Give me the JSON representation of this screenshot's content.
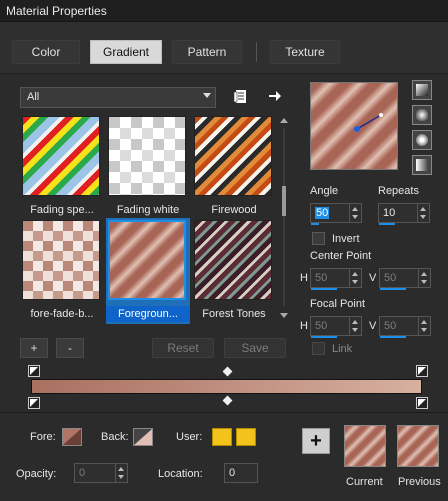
{
  "window": {
    "title": "Material Properties"
  },
  "tabs": [
    {
      "label": "Color",
      "active": false
    },
    {
      "label": "Gradient",
      "active": true
    },
    {
      "label": "Pattern",
      "active": false
    },
    {
      "label": "Texture",
      "active": false
    }
  ],
  "library": {
    "category": "All",
    "thumbnails": [
      {
        "label": "Fading spe...",
        "selected": false
      },
      {
        "label": "Fading white",
        "selected": false
      },
      {
        "label": "Firewood",
        "selected": false
      },
      {
        "label": "fore-fade-b...",
        "selected": false
      },
      {
        "label": "Foregroun...",
        "selected": true
      },
      {
        "label": "Forest Tones",
        "selected": false
      }
    ],
    "buttons": {
      "add": "+",
      "remove": "-",
      "reset": "Reset",
      "save": "Save"
    }
  },
  "settings": {
    "angle_label": "Angle",
    "angle_value": "50",
    "repeats_label": "Repeats",
    "repeats_value": "10",
    "invert_label": "Invert",
    "center_point_label": "Center Point",
    "center_h_label": "H",
    "center_h_value": "50",
    "center_v_label": "V",
    "center_v_value": "50",
    "focal_point_label": "Focal Point",
    "focal_h_label": "H",
    "focal_h_value": "50",
    "focal_v_label": "V",
    "focal_v_value": "50",
    "link_label": "Link"
  },
  "footer": {
    "fore_label": "Fore:",
    "back_label": "Back:",
    "user_label": "User:",
    "opacity_label": "Opacity:",
    "opacity_value": "0",
    "location_label": "Location:",
    "location_value": "0",
    "add_button": "+",
    "current_label": "Current",
    "previous_label": "Previous"
  },
  "colors": {
    "accent": "#1e8fe8",
    "foreground": "#a86555",
    "background": "#e0c0b4",
    "user": "#f2c31a"
  }
}
